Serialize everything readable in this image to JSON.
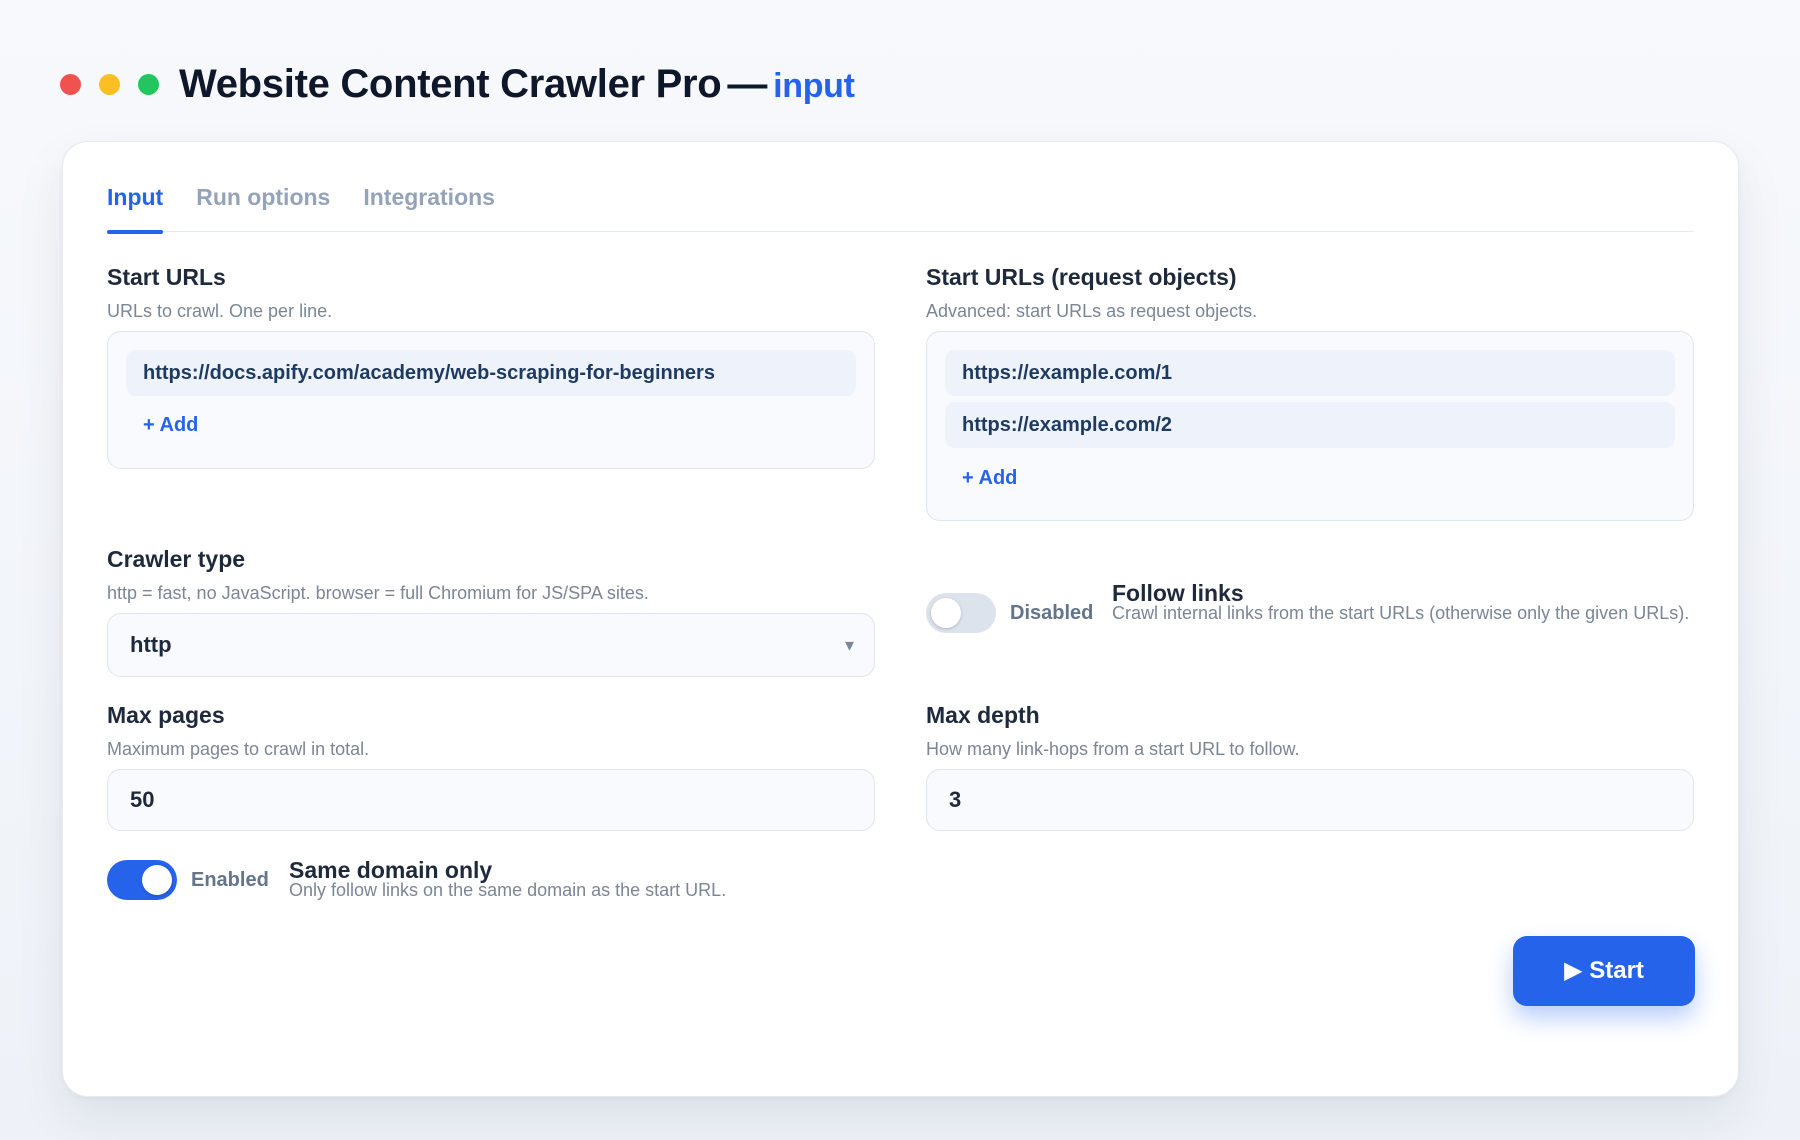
{
  "window": {
    "title": "Website Content Crawler Pro",
    "separator": "—",
    "subtitle": "input",
    "colors": {
      "close": "#ef5350",
      "minimize": "#fbbf24",
      "maximize": "#22c55e",
      "accent": "#2563eb"
    }
  },
  "tabs": [
    {
      "label": "Input",
      "active": true
    },
    {
      "label": "Run options",
      "active": false
    },
    {
      "label": "Integrations",
      "active": false
    }
  ],
  "start_urls": {
    "label": "Start URLs",
    "hint": "URLs to crawl. One per line.",
    "items": [
      "https://docs.apify.com/academy/web-scraping-for-beginners"
    ],
    "add_label": "+ Add"
  },
  "request_objects": {
    "label": "Start URLs (request objects)",
    "hint": "Advanced: start URLs as request objects.",
    "items": [
      "https://example.com/1",
      "https://example.com/2"
    ],
    "add_label": "+ Add"
  },
  "crawler_type": {
    "label": "Crawler type",
    "hint": "http = fast, no JavaScript. browser = full Chromium for JS/SPA sites.",
    "value": "http",
    "caret": "▾"
  },
  "follow_links": {
    "state_label": "Disabled",
    "enabled": false,
    "title": "Follow links",
    "description": "Crawl internal links from the start URLs (otherwise only the given URLs)."
  },
  "max_pages": {
    "label": "Max pages",
    "hint": "Maximum pages to crawl in total.",
    "value": "50"
  },
  "max_depth": {
    "label": "Max depth",
    "hint": "How many link-hops from a start URL to follow.",
    "value": "3"
  },
  "same_domain": {
    "state_label": "Enabled",
    "enabled": true,
    "title": "Same domain only",
    "description": "Only follow links on the same domain as the start URL."
  },
  "actions": {
    "start_label": "▶ Start"
  }
}
